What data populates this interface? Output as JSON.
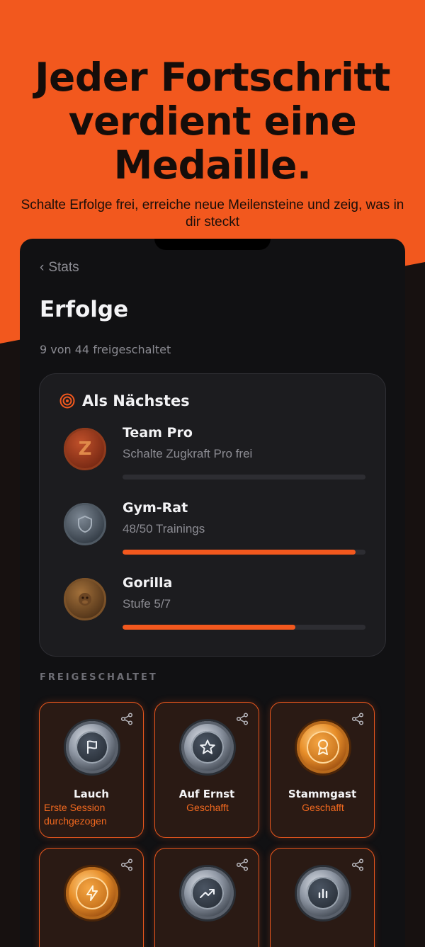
{
  "headline": [
    "Jeder Fortschritt",
    "verdient eine",
    "Medaille."
  ],
  "subline": "Schalte Erfolge frei, erreiche neue Meilensteine und zeig, was in dir steckt",
  "nav": {
    "back_label": "Stats"
  },
  "page": {
    "title": "Erfolge",
    "unlocked_count": "9 von 44 freigeschaltet"
  },
  "next": {
    "heading": "Als Nächstes",
    "items": [
      {
        "name": "Team Pro",
        "desc": "Schalte Zugkraft Pro frei",
        "progress": 0.0,
        "letter": "Z"
      },
      {
        "name": "Gym-Rat",
        "desc": "48/50 Trainings",
        "progress": 0.96
      },
      {
        "name": "Gorilla",
        "desc": "Stufe 5/7",
        "progress": 0.71
      }
    ]
  },
  "unlocked": {
    "section_label": "FREIGESCHALTET",
    "tiles": [
      {
        "name": "Lauch",
        "sub": "Erste Session durchgezogen",
        "icon": "flag-icon",
        "tier": "silver"
      },
      {
        "name": "Auf Ernst",
        "sub": "Geschafft",
        "icon": "star-icon",
        "tier": "silver"
      },
      {
        "name": "Stammgast",
        "sub": "Geschafft",
        "icon": "ribbon-icon",
        "tier": "gold"
      },
      {
        "name": "",
        "sub": "",
        "icon": "lightning-icon",
        "tier": "gold"
      },
      {
        "name": "",
        "sub": "",
        "icon": "trend-up-icon",
        "tier": "silver"
      },
      {
        "name": "",
        "sub": "",
        "icon": "bar-chart-icon",
        "tier": "silver"
      }
    ]
  },
  "colors": {
    "accent": "#f2581e",
    "background": "#171110",
    "card": "#1c1c1f"
  }
}
